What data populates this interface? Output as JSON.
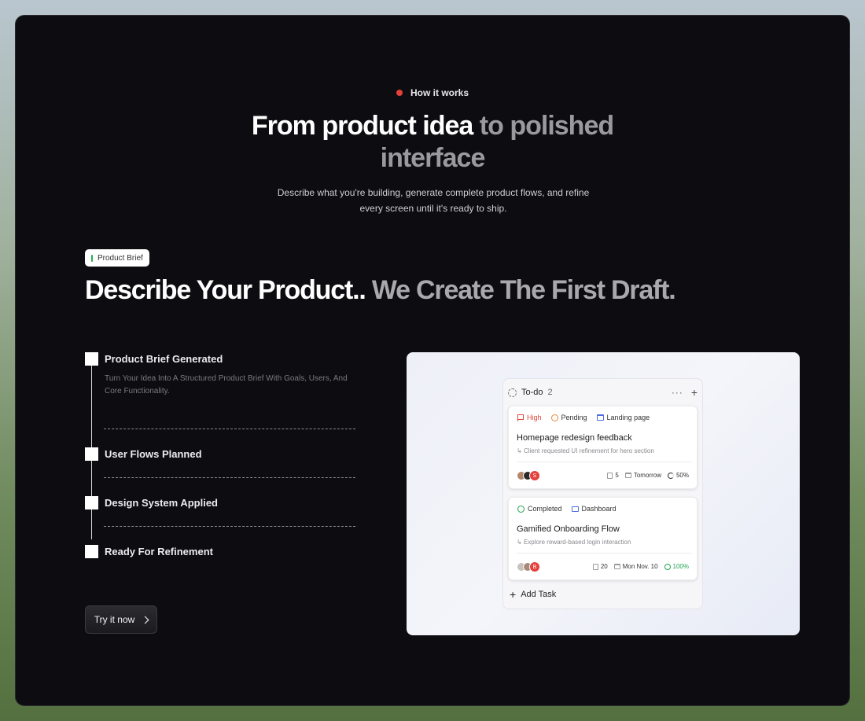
{
  "eyebrow": {
    "label": "How it works",
    "dot_color": "#e5413c"
  },
  "hero": {
    "title_main": "From product idea",
    "title_muted_1": "to polished",
    "title_muted_2": "interface",
    "subtitle_line_1": "Describe what you're building, generate complete product flows, and refine",
    "subtitle_line_2": "every screen until it's ready to ship."
  },
  "section": {
    "badge": "Product Brief",
    "title_main": "Describe Your Product..",
    "title_muted": "We Create The First Draft."
  },
  "steps": [
    {
      "label": "Product Brief Generated",
      "desc": "Turn Your Idea Into A Structured Product Brief With Goals, Users, And Core Functionality."
    },
    {
      "label": "User Flows Planned"
    },
    {
      "label": "Design System Applied"
    },
    {
      "label": "Ready For Refinement"
    }
  ],
  "cta": {
    "label": "Try it now",
    "icon": "chevron-right-icon"
  },
  "preview": {
    "column_title": "To-do",
    "column_count": "2",
    "add_task": "Add Task",
    "cards": [
      {
        "tags": [
          {
            "label": "High",
            "icon": "flag-icon"
          },
          {
            "label": "Pending",
            "icon": "clock-icon"
          },
          {
            "label": "Landing page",
            "icon": "page-icon"
          }
        ],
        "title": "Homepage redesign feedback",
        "subtitle": "Client requested UI refinement for hero section",
        "avatar_initial": "S",
        "comments": "5",
        "due": "Tomorrow",
        "progress": "50%"
      },
      {
        "tags": [
          {
            "label": "Completed",
            "icon": "check-circle-icon"
          },
          {
            "label": "Dashboard",
            "icon": "monitor-icon"
          }
        ],
        "title": "Gamified Onboarding Flow",
        "subtitle": "Explore reward-based login interaction",
        "avatar_initial": "B",
        "comments": "20",
        "due": "Mon Nov. 10",
        "progress": "100%"
      }
    ]
  }
}
